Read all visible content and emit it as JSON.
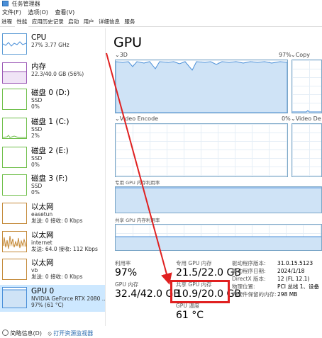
{
  "window": {
    "title": "任务管理器"
  },
  "menu": [
    "文件(F)",
    "选项(O)",
    "查看(V)"
  ],
  "tabs": [
    "进程",
    "性能",
    "应用历史记录",
    "启动",
    "用户",
    "详细信息",
    "服务"
  ],
  "active_tab": "性能",
  "sidebar": {
    "items": [
      {
        "title": "CPU",
        "sub1": "27% 3.77 GHz",
        "sub2": "",
        "sub3": ""
      },
      {
        "title": "内存",
        "sub1": "22.3/40.0 GB (56%)",
        "sub2": "",
        "sub3": ""
      },
      {
        "title": "磁盘 0 (D:)",
        "sub1": "SSD",
        "sub2": "0%",
        "sub3": ""
      },
      {
        "title": "磁盘 1 (C:)",
        "sub1": "SSD",
        "sub2": "2%",
        "sub3": ""
      },
      {
        "title": "磁盘 2 (E:)",
        "sub1": "SSD",
        "sub2": "0%",
        "sub3": ""
      },
      {
        "title": "磁盘 3 (F:)",
        "sub1": "SSD",
        "sub2": "0%",
        "sub3": ""
      },
      {
        "title": "以太网",
        "sub1": "easetun",
        "sub2": "发送: 0 接收: 0 Kbps",
        "sub3": ""
      },
      {
        "title": "以太网",
        "sub1": "internet",
        "sub2": "发送: 64.0 接收: 112 Kbps",
        "sub3": ""
      },
      {
        "title": "以太网",
        "sub1": "vb",
        "sub2": "发送: 0 接收: 0 Kbps",
        "sub3": ""
      },
      {
        "title": "GPU 0",
        "sub1": "NVIDIA GeForce RTX 2080 ...",
        "sub2": "97% (61 °C)",
        "sub3": ""
      }
    ]
  },
  "main": {
    "title": "GPU",
    "graph1_left": "3D",
    "graph1_pct": "97%",
    "graph1_right": "Copy",
    "graph2_left": "Video Encode",
    "graph2_pct": "0%",
    "graph2_right": "Video De",
    "dedicated_label": "专用 GPU 内存利用率",
    "shared_label": "共享 GPU 内存利用率",
    "stats": {
      "util_label": "利用率",
      "util_value": "97%",
      "dedicated_mem_label": "专用 GPU 内存",
      "dedicated_mem_value": "21.5/22.0 GB",
      "gpu_mem_label": "GPU 内存",
      "gpu_mem_value": "32.4/42.0 GB",
      "shared_mem_label": "共享 GPU 内存",
      "shared_mem_value": "10.9/20.0 GB",
      "temp_label": "GPU 温度",
      "temp_value": "61 °C"
    },
    "info": [
      {
        "label": "驱动程序版本:",
        "value": "31.0.15.5123"
      },
      {
        "label": "驱动程序日期:",
        "value": "2024/1/18"
      },
      {
        "label": "DirectX 版本:",
        "value": "12 (FL 12.1)"
      },
      {
        "label": "物理位置:",
        "value": "PCI 总线 1、设备"
      },
      {
        "label": "为硬件保留的内存:",
        "value": "298 MB"
      }
    ]
  },
  "footer": {
    "less": "简略信息(D)",
    "open": "打开资源监视器"
  },
  "colors": {
    "accent_highlight": "#e02020",
    "gpu_graph": "#4a8fd8",
    "selected": "#cde8ff"
  }
}
